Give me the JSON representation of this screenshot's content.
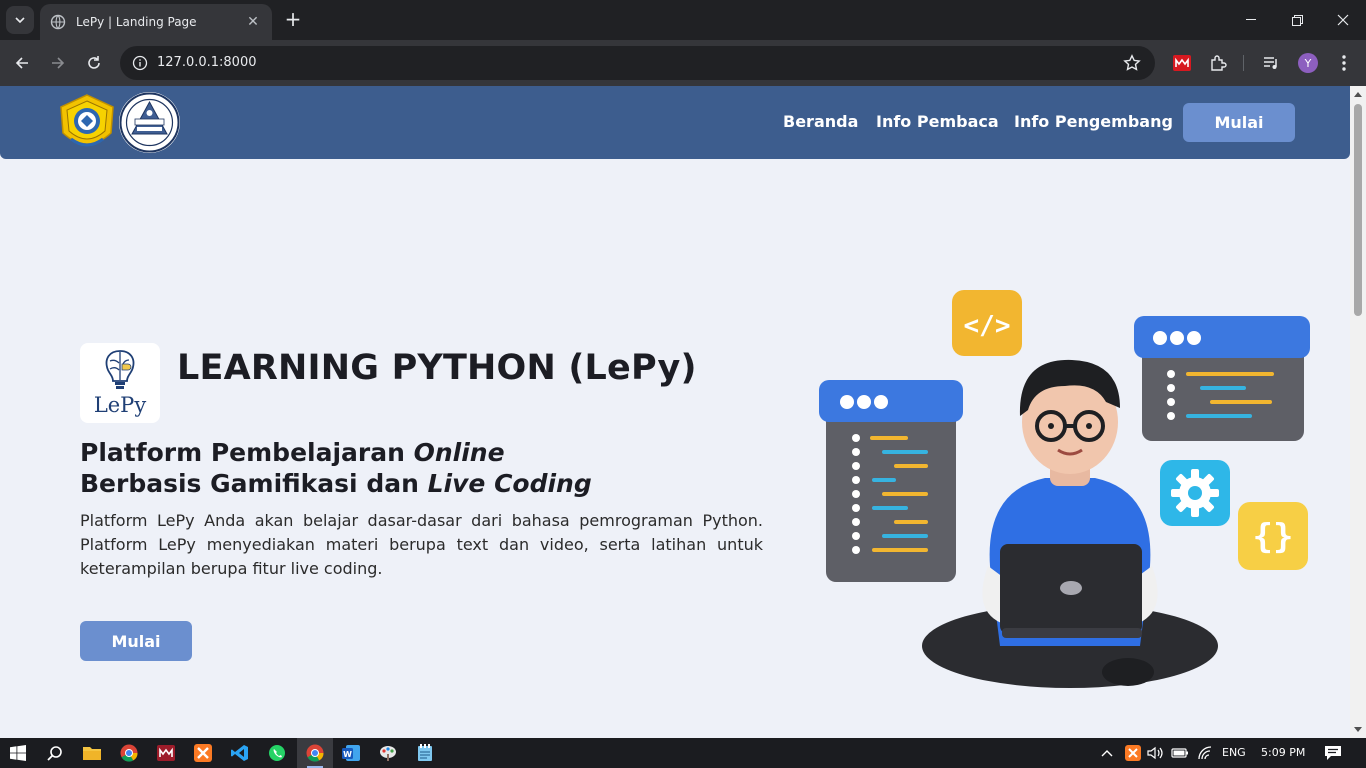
{
  "browser": {
    "tab_title": "LePy | Landing Page",
    "url": "127.0.0.1:8000",
    "profile_initial": "Y"
  },
  "navbar": {
    "links": [
      "Beranda",
      "Info Pembaca",
      "Info Pengembang"
    ],
    "cta": "Mulai"
  },
  "hero": {
    "logo_text": "LePy",
    "title": "LEARNING PYTHON (LePy)",
    "subtitle_line1_plain": "Platform Pembelajaran ",
    "subtitle_line1_italic": "Online",
    "subtitle_line2_plain": "Berbasis Gamifikasi dan ",
    "subtitle_line2_italic": "Live Coding",
    "description": "Platform LePy Anda akan belajar dasar-dasar dari bahasa pemrograman Python. Platform LePy menyediakan materi berupa text dan video, serta latihan untuk keterampilan berupa fitur live coding.",
    "cta": "Mulai"
  },
  "taskbar": {
    "language": "ENG",
    "time": "5:09 PM"
  },
  "colors": {
    "navbar": "#3d5d8e",
    "button": "#6b8fcf",
    "page_bg": "#eef1f8"
  }
}
